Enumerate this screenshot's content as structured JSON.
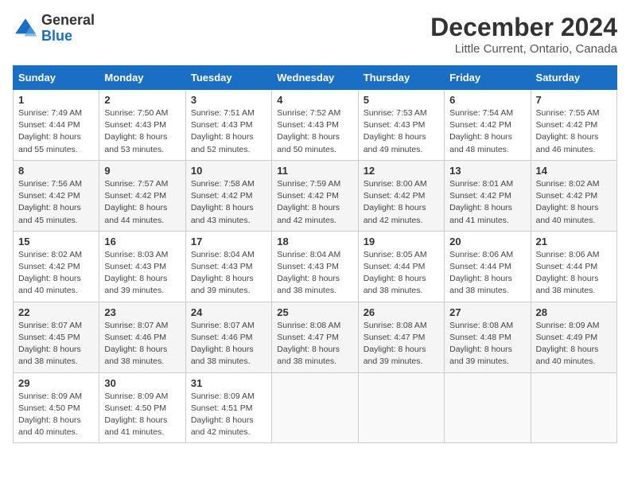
{
  "header": {
    "logo_line1": "General",
    "logo_line2": "Blue",
    "title": "December 2024",
    "subtitle": "Little Current, Ontario, Canada"
  },
  "calendar": {
    "days_of_week": [
      "Sunday",
      "Monday",
      "Tuesday",
      "Wednesday",
      "Thursday",
      "Friday",
      "Saturday"
    ],
    "weeks": [
      [
        {
          "day": "1",
          "sunrise": "7:49 AM",
          "sunset": "4:44 PM",
          "daylight": "8 hours and 55 minutes."
        },
        {
          "day": "2",
          "sunrise": "7:50 AM",
          "sunset": "4:43 PM",
          "daylight": "8 hours and 53 minutes."
        },
        {
          "day": "3",
          "sunrise": "7:51 AM",
          "sunset": "4:43 PM",
          "daylight": "8 hours and 52 minutes."
        },
        {
          "day": "4",
          "sunrise": "7:52 AM",
          "sunset": "4:43 PM",
          "daylight": "8 hours and 50 minutes."
        },
        {
          "day": "5",
          "sunrise": "7:53 AM",
          "sunset": "4:43 PM",
          "daylight": "8 hours and 49 minutes."
        },
        {
          "day": "6",
          "sunrise": "7:54 AM",
          "sunset": "4:42 PM",
          "daylight": "8 hours and 48 minutes."
        },
        {
          "day": "7",
          "sunrise": "7:55 AM",
          "sunset": "4:42 PM",
          "daylight": "8 hours and 46 minutes."
        }
      ],
      [
        {
          "day": "8",
          "sunrise": "7:56 AM",
          "sunset": "4:42 PM",
          "daylight": "8 hours and 45 minutes."
        },
        {
          "day": "9",
          "sunrise": "7:57 AM",
          "sunset": "4:42 PM",
          "daylight": "8 hours and 44 minutes."
        },
        {
          "day": "10",
          "sunrise": "7:58 AM",
          "sunset": "4:42 PM",
          "daylight": "8 hours and 43 minutes."
        },
        {
          "day": "11",
          "sunrise": "7:59 AM",
          "sunset": "4:42 PM",
          "daylight": "8 hours and 42 minutes."
        },
        {
          "day": "12",
          "sunrise": "8:00 AM",
          "sunset": "4:42 PM",
          "daylight": "8 hours and 42 minutes."
        },
        {
          "day": "13",
          "sunrise": "8:01 AM",
          "sunset": "4:42 PM",
          "daylight": "8 hours and 41 minutes."
        },
        {
          "day": "14",
          "sunrise": "8:02 AM",
          "sunset": "4:42 PM",
          "daylight": "8 hours and 40 minutes."
        }
      ],
      [
        {
          "day": "15",
          "sunrise": "8:02 AM",
          "sunset": "4:42 PM",
          "daylight": "8 hours and 40 minutes."
        },
        {
          "day": "16",
          "sunrise": "8:03 AM",
          "sunset": "4:43 PM",
          "daylight": "8 hours and 39 minutes."
        },
        {
          "day": "17",
          "sunrise": "8:04 AM",
          "sunset": "4:43 PM",
          "daylight": "8 hours and 39 minutes."
        },
        {
          "day": "18",
          "sunrise": "8:04 AM",
          "sunset": "4:43 PM",
          "daylight": "8 hours and 38 minutes."
        },
        {
          "day": "19",
          "sunrise": "8:05 AM",
          "sunset": "4:44 PM",
          "daylight": "8 hours and 38 minutes."
        },
        {
          "day": "20",
          "sunrise": "8:06 AM",
          "sunset": "4:44 PM",
          "daylight": "8 hours and 38 minutes."
        },
        {
          "day": "21",
          "sunrise": "8:06 AM",
          "sunset": "4:44 PM",
          "daylight": "8 hours and 38 minutes."
        }
      ],
      [
        {
          "day": "22",
          "sunrise": "8:07 AM",
          "sunset": "4:45 PM",
          "daylight": "8 hours and 38 minutes."
        },
        {
          "day": "23",
          "sunrise": "8:07 AM",
          "sunset": "4:46 PM",
          "daylight": "8 hours and 38 minutes."
        },
        {
          "day": "24",
          "sunrise": "8:07 AM",
          "sunset": "4:46 PM",
          "daylight": "8 hours and 38 minutes."
        },
        {
          "day": "25",
          "sunrise": "8:08 AM",
          "sunset": "4:47 PM",
          "daylight": "8 hours and 38 minutes."
        },
        {
          "day": "26",
          "sunrise": "8:08 AM",
          "sunset": "4:47 PM",
          "daylight": "8 hours and 39 minutes."
        },
        {
          "day": "27",
          "sunrise": "8:08 AM",
          "sunset": "4:48 PM",
          "daylight": "8 hours and 39 minutes."
        },
        {
          "day": "28",
          "sunrise": "8:09 AM",
          "sunset": "4:49 PM",
          "daylight": "8 hours and 40 minutes."
        }
      ],
      [
        {
          "day": "29",
          "sunrise": "8:09 AM",
          "sunset": "4:50 PM",
          "daylight": "8 hours and 40 minutes."
        },
        {
          "day": "30",
          "sunrise": "8:09 AM",
          "sunset": "4:50 PM",
          "daylight": "8 hours and 41 minutes."
        },
        {
          "day": "31",
          "sunrise": "8:09 AM",
          "sunset": "4:51 PM",
          "daylight": "8 hours and 42 minutes."
        },
        null,
        null,
        null,
        null
      ]
    ]
  }
}
